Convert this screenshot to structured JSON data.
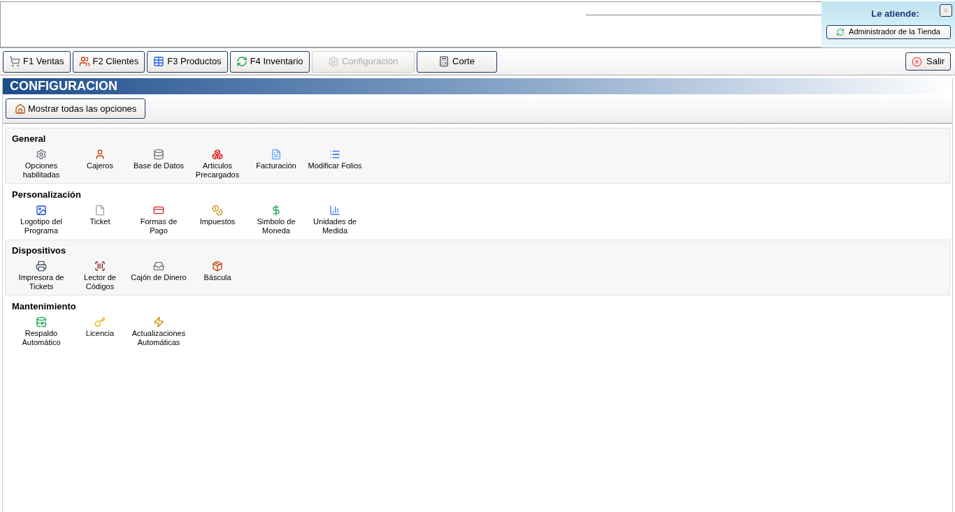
{
  "attendant": {
    "label": "Le atiende:",
    "button": "Administrador de la Tienda"
  },
  "toolbar": [
    {
      "label": "F1 Ventas",
      "kind": "cart",
      "disabled": false
    },
    {
      "label": "F2 Clientes",
      "kind": "users",
      "disabled": false
    },
    {
      "label": "F3 Productos",
      "kind": "table",
      "disabled": false
    },
    {
      "label": "F4 Inventario",
      "kind": "refresh",
      "disabled": false
    },
    {
      "label": "Configuración",
      "kind": "gear",
      "disabled": true
    },
    {
      "label": "Corte",
      "kind": "calculator",
      "disabled": false
    }
  ],
  "exit_button": "Salir",
  "page_title": "CONFIGURACION",
  "show_all_button": "Mostrar todas las opciones",
  "sections": [
    {
      "title": "General",
      "items": [
        {
          "label": "Opciones habilitadas",
          "kind": "gear"
        },
        {
          "label": "Cajeros",
          "kind": "user"
        },
        {
          "label": "Base de Datos",
          "kind": "database"
        },
        {
          "label": "Articulos Precargados",
          "kind": "boxes"
        },
        {
          "label": "Facturación",
          "kind": "document"
        },
        {
          "label": "Modificar Folios",
          "kind": "list"
        }
      ]
    },
    {
      "title": "Personalización",
      "items": [
        {
          "label": "Logotipo del Programa",
          "kind": "picture"
        },
        {
          "label": "Ticket",
          "kind": "page"
        },
        {
          "label": "Formas de Pago",
          "kind": "card"
        },
        {
          "label": "Impuestos",
          "kind": "coins"
        },
        {
          "label": "Simbolo de Moneda",
          "kind": "dollar"
        },
        {
          "label": "Unidades de Medida",
          "kind": "bars"
        }
      ]
    },
    {
      "title": "Dispositivos",
      "items": [
        {
          "label": "Impresora de Tickets",
          "kind": "printer"
        },
        {
          "label": "Lector de Códigos",
          "kind": "scanner"
        },
        {
          "label": "Cajón de Dinero",
          "kind": "drawer"
        },
        {
          "label": "Báscula",
          "kind": "package"
        }
      ]
    },
    {
      "title": "Mantenimiento",
      "items": [
        {
          "label": "Respaldo Automático",
          "kind": "backup"
        },
        {
          "label": "Licencia",
          "kind": "key"
        },
        {
          "label": "Actualizaciones Automáticas",
          "kind": "update"
        }
      ]
    }
  ]
}
